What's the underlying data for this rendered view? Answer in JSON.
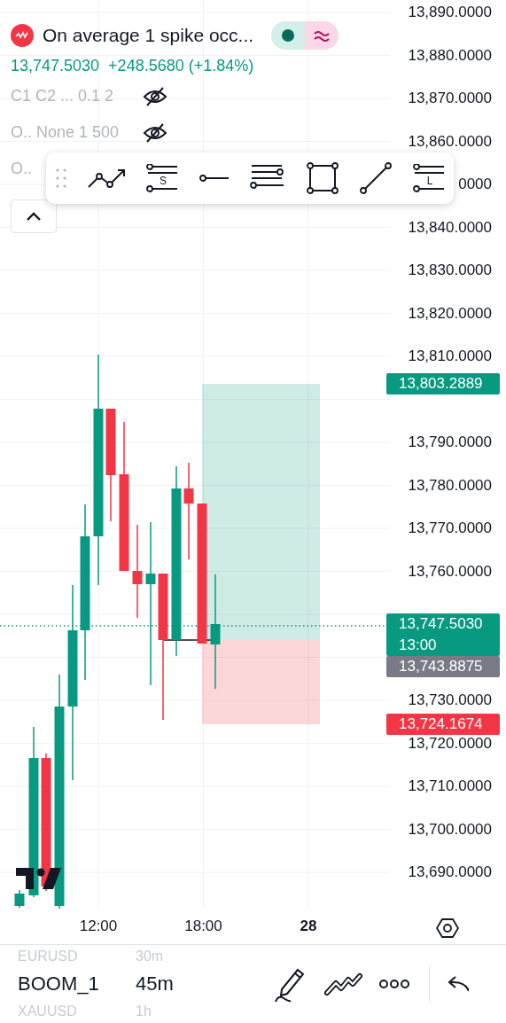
{
  "header": {
    "title": "On average 1 spike occ...",
    "price": "13,747.5030",
    "change": "+248.5680 (+1.84%)"
  },
  "indicators": [
    {
      "label": "C1 C2 ... 0.1 2",
      "hidden": true
    },
    {
      "label": "O.. None 1 500",
      "hidden": true
    },
    {
      "label": "O.."
    }
  ],
  "drawing_toolbar": {
    "tools": [
      {
        "kind": "path"
      },
      {
        "kind": "levels",
        "letter": "S"
      },
      {
        "kind": "ray"
      },
      {
        "kind": "lines"
      },
      {
        "kind": "rectangle"
      },
      {
        "kind": "segment"
      },
      {
        "kind": "levels",
        "letter": "L"
      }
    ]
  },
  "price_axis": {
    "label_groups": [
      {
        "labels": [
          "13,890.0000",
          "13,880.0000",
          "13,870.0000",
          "13,860.0000"
        ]
      },
      {
        "labels": [
          "0000",
          "13,840.0000",
          "13,830.0000",
          "13,820.0000",
          "13,810.0000"
        ]
      },
      {
        "labels": [
          "13,790.0000",
          "13,780.0000",
          "13,770.0000",
          "13,760.0000"
        ]
      },
      {
        "labels": [
          "13,730.0000",
          "13,720.0000",
          "13,710.0000",
          "13,700.0000",
          "13,690.0000"
        ]
      }
    ],
    "tags": [
      {
        "kind": "target",
        "text": "13,803.2889"
      },
      {
        "kind": "last",
        "text": "13,747.5030",
        "sub": "13:00"
      },
      {
        "kind": "entry",
        "text": "13,743.8875"
      },
      {
        "kind": "stop",
        "text": "13,724.1674"
      }
    ]
  },
  "time_axis": [
    {
      "text": "12:00",
      "bold": false
    },
    {
      "text": "18:00",
      "bold": false
    },
    {
      "text": "28",
      "bold": true
    }
  ],
  "picker": [
    {
      "symbol": "EURUSD",
      "interval": "30m",
      "selected": false
    },
    {
      "symbol": "BOOM_1",
      "interval": "45m",
      "selected": true
    },
    {
      "symbol": "XAUUSD",
      "interval": "1h",
      "selected": false
    }
  ]
}
